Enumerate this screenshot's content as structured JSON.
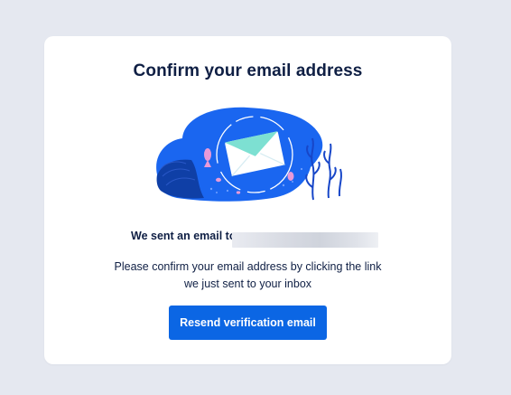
{
  "card": {
    "title": "Confirm your email address",
    "sent_label": "We sent an email to",
    "description_line1": "Please confirm your email address by clicking the link",
    "description_line2": "we just sent to your inbox",
    "resend_button_label": "Resend verification email"
  },
  "icons": {
    "illustration": "email-envelope-underwater-icon"
  },
  "colors": {
    "page_background": "#e5e8f0",
    "card_background": "#ffffff",
    "text": "#0f1f44",
    "button": "#0b66e4",
    "illustration_blue": "#1a66f0",
    "envelope_teal": "#7de0d2",
    "fish_pink": "#e99ad8"
  }
}
